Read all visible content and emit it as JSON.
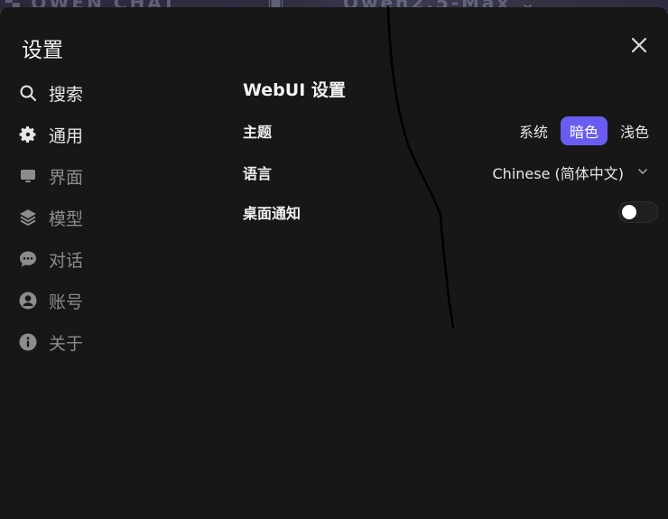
{
  "modal": {
    "title": "设置"
  },
  "sidebar": {
    "items": [
      {
        "label": "搜索",
        "icon": "search-icon",
        "active": false
      },
      {
        "label": "通用",
        "icon": "gear-icon",
        "active": true
      },
      {
        "label": "界面",
        "icon": "monitor-icon",
        "active": false
      },
      {
        "label": "模型",
        "icon": "layers-icon",
        "active": false
      },
      {
        "label": "对话",
        "icon": "chat-bubble-icon",
        "active": false
      },
      {
        "label": "账号",
        "icon": "user-icon",
        "active": false
      },
      {
        "label": "关于",
        "icon": "info-icon",
        "active": false
      }
    ]
  },
  "general": {
    "section_title": "WebUI 设置",
    "theme": {
      "label": "主题",
      "options": [
        "系统",
        "暗色",
        "浅色"
      ],
      "selected": "暗色"
    },
    "language": {
      "label": "语言",
      "value": "Chinese (简体中文)"
    },
    "notifications": {
      "label": "桌面通知",
      "enabled": false
    }
  },
  "colors": {
    "modal_bg": "#171717",
    "accent": "#6a5cf0",
    "text_primary": "#ececec",
    "text_muted": "#8c8c8c"
  }
}
